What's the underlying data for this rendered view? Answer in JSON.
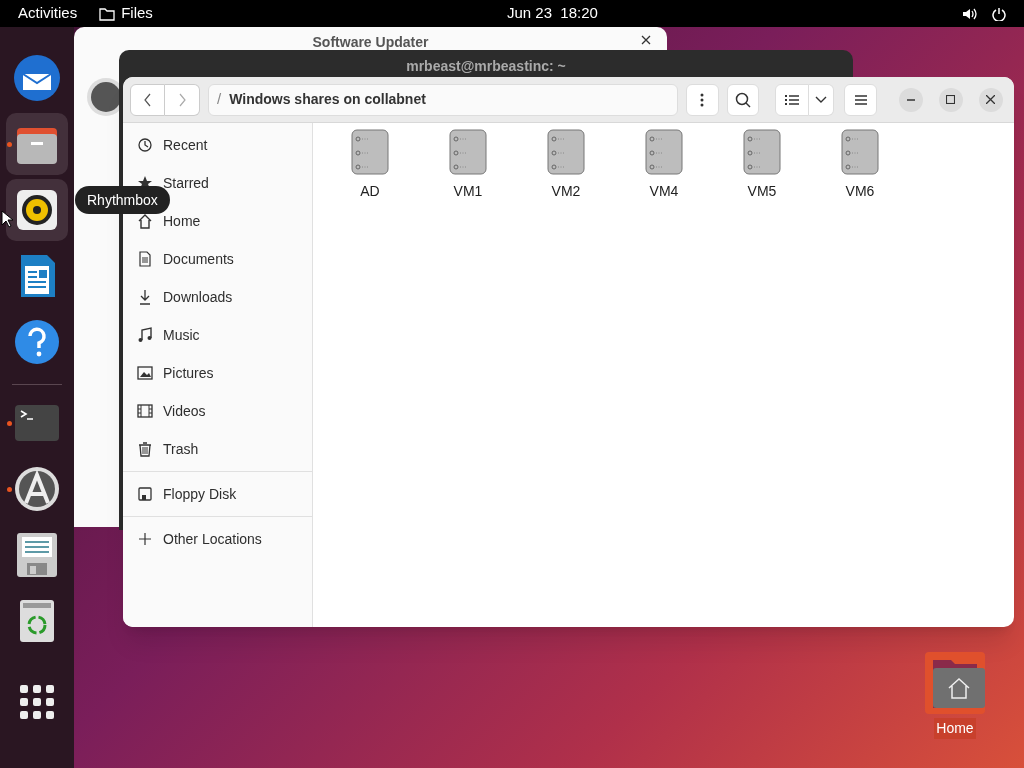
{
  "top_bar": {
    "activities": "Activities",
    "app_name": "Files",
    "clock": "Jun 23  18:20"
  },
  "dock": {
    "items": [
      {
        "kind": "mail",
        "running": false,
        "highlighted": false
      },
      {
        "kind": "files",
        "running": true,
        "highlighted": true
      },
      {
        "kind": "music",
        "running": false,
        "highlighted": true
      },
      {
        "kind": "writer",
        "running": false,
        "highlighted": false
      },
      {
        "kind": "help",
        "running": false,
        "highlighted": false
      },
      {
        "kind": "separator"
      },
      {
        "kind": "terminal",
        "running": true,
        "highlighted": false
      },
      {
        "kind": "updater",
        "running": true,
        "highlighted": false
      },
      {
        "kind": "disk",
        "running": false,
        "highlighted": false
      },
      {
        "kind": "trash",
        "running": false,
        "highlighted": false
      }
    ],
    "tooltip": "Rhythmbox"
  },
  "background_windows": [
    {
      "kind": "dialog",
      "title": "Software Updater"
    },
    {
      "kind": "terminal",
      "title": "mrbeast@mrbeastinc: ~"
    }
  ],
  "files_window": {
    "path_separator": "/",
    "path": "Windows shares on collabnet",
    "sidebar": {
      "groups": [
        {
          "items": [
            {
              "kind": "recent",
              "label": "Recent"
            },
            {
              "kind": "starred",
              "label": "Starred"
            },
            {
              "kind": "home",
              "label": "Home"
            },
            {
              "kind": "documents",
              "label": "Documents"
            },
            {
              "kind": "downloads",
              "label": "Downloads"
            },
            {
              "kind": "music",
              "label": "Music"
            },
            {
              "kind": "pictures",
              "label": "Pictures"
            },
            {
              "kind": "videos",
              "label": "Videos"
            },
            {
              "kind": "trash",
              "label": "Trash"
            }
          ]
        },
        {
          "items": [
            {
              "kind": "floppy",
              "label": "Floppy Disk"
            }
          ]
        },
        {
          "items": [
            {
              "kind": "add",
              "label": "Other Locations"
            }
          ]
        }
      ]
    },
    "shares": [
      "AD",
      "VM1",
      "VM2",
      "VM4",
      "VM5",
      "VM6"
    ]
  },
  "desktop_icons": [
    {
      "label": "Home"
    }
  ]
}
